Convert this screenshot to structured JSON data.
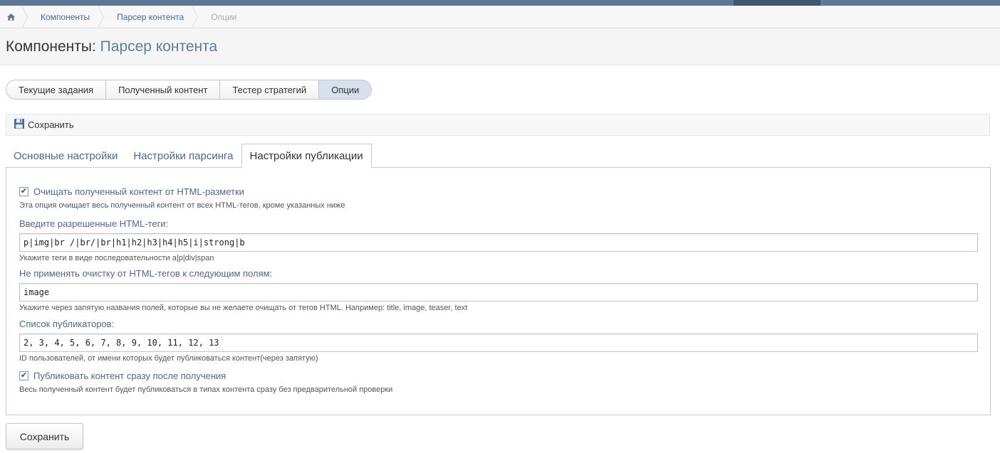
{
  "breadcrumb": {
    "home_icon": "home-icon",
    "items": [
      "Компоненты",
      "Парсер контента",
      "Опции"
    ]
  },
  "header": {
    "title_prefix": "Компоненты:",
    "title_sub": "Парсер контента"
  },
  "section_tabs": [
    {
      "label": "Текущие задания",
      "active": false
    },
    {
      "label": "Полученный контент",
      "active": false
    },
    {
      "label": "Тестер стратегий",
      "active": false
    },
    {
      "label": "Опции",
      "active": true
    }
  ],
  "toolbar": {
    "save_icon": "floppy-disk-icon",
    "save_label": "Сохранить"
  },
  "settings_tabs": [
    {
      "label": "Основные настройки",
      "active": false
    },
    {
      "label": "Настройки парсинга",
      "active": false
    },
    {
      "label": "Настройки публикации",
      "active": true
    }
  ],
  "form": {
    "strip_html": {
      "checked": true,
      "label": "Очищать полученный контент от HTML-разметки",
      "hint": "Эта опция очищает весь полученный контент от всех HTML-тегов, кроме указанных ниже"
    },
    "allowed_tags": {
      "label": "Введите разрешенные HTML-теги:",
      "value": "p|img|br /|br/|br|h1|h2|h3|h4|h5|i|strong|b",
      "hint": "Укажите теги в виде последовательности a|p|div|span"
    },
    "skip_fields": {
      "label": "Не применять очистку от HTML-тегов к следующим полям:",
      "value": "image",
      "hint": "Укажите через запятую названия полей, которые вы не желаете очищать от тегов HTML. Например: title, image, teaser, text"
    },
    "publishers": {
      "label": "Список публикаторов:",
      "value": "2, 3, 4, 5, 6, 7, 8, 9, 10, 11, 12, 13",
      "hint": "ID пользователей, от имени которых будет публиковаться контент(через запятую)"
    },
    "publish_immediately": {
      "checked": true,
      "label": "Публиковать контент сразу после получения",
      "hint": "Весь полученный контент будет публиковаться в типах контента сразу без предварительной проверки"
    }
  },
  "footer": {
    "save_label": "Сохранить"
  },
  "colors": {
    "topbar": "#5d7894",
    "link": "#4a6a8a",
    "active_tab": "#d6e1ec"
  }
}
